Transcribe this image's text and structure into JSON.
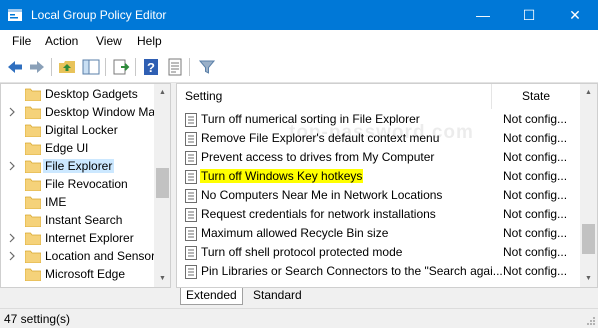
{
  "window": {
    "title": "Local Group Policy Editor",
    "minimize": "—",
    "maximize": "☐",
    "close": "✕"
  },
  "menu": {
    "items": [
      "File",
      "Action",
      "View",
      "Help"
    ]
  },
  "toolbar": {
    "buttons": [
      "back-arrow-icon",
      "forward-arrow-icon",
      "up-folder-icon",
      "show-hide-tree-icon",
      "export-list-icon",
      "help-icon",
      "properties-icon",
      "filter-icon"
    ]
  },
  "tree": {
    "items": [
      {
        "label": "Desktop Gadgets",
        "expandable": false,
        "selected": false
      },
      {
        "label": "Desktop Window Ma",
        "expandable": true,
        "selected": false
      },
      {
        "label": "Digital Locker",
        "expandable": false,
        "selected": false
      },
      {
        "label": "Edge UI",
        "expandable": false,
        "selected": false
      },
      {
        "label": "File Explorer",
        "expandable": true,
        "selected": true
      },
      {
        "label": "File Revocation",
        "expandable": false,
        "selected": false
      },
      {
        "label": "IME",
        "expandable": false,
        "selected": false
      },
      {
        "label": "Instant Search",
        "expandable": false,
        "selected": false
      },
      {
        "label": "Internet Explorer",
        "expandable": true,
        "selected": false
      },
      {
        "label": "Location and Sensors",
        "expandable": true,
        "selected": false
      },
      {
        "label": "Microsoft Edge",
        "expandable": false,
        "selected": false
      }
    ]
  },
  "list": {
    "headers": {
      "setting": "Setting",
      "state": "State"
    },
    "watermark": "top-password.com",
    "rows": [
      {
        "name": "Turn off numerical sorting in File Explorer",
        "state": "Not config...",
        "highlighted": false
      },
      {
        "name": "Remove File Explorer's default context menu",
        "state": "Not config...",
        "highlighted": false
      },
      {
        "name": "Prevent access to drives from My Computer",
        "state": "Not config...",
        "highlighted": false
      },
      {
        "name": "Turn off Windows Key hotkeys",
        "state": "Not config...",
        "highlighted": true
      },
      {
        "name": "No Computers Near Me in Network Locations",
        "state": "Not config...",
        "highlighted": false
      },
      {
        "name": "Request credentials for network installations",
        "state": "Not config...",
        "highlighted": false
      },
      {
        "name": "Maximum allowed Recycle Bin size",
        "state": "Not config...",
        "highlighted": false
      },
      {
        "name": "Turn off shell protocol protected mode",
        "state": "Not config...",
        "highlighted": false
      },
      {
        "name": "Pin Libraries or Search Connectors to the \"Search agai...",
        "state": "Not config...",
        "highlighted": false
      }
    ]
  },
  "tabs": {
    "extended": "Extended",
    "standard": "Standard"
  },
  "status": {
    "text": "47 setting(s)"
  },
  "colors": {
    "titlebar": "#0078d7",
    "selection": "#cce8ff",
    "highlight": "#ffff00"
  }
}
